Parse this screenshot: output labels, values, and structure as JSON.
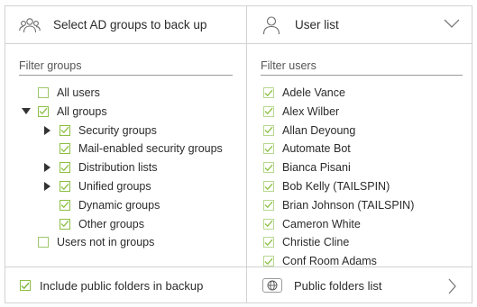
{
  "groups_panel": {
    "title": "Select AD groups to back up",
    "icon": "people-icon",
    "filter_label": "Filter groups",
    "items": [
      {
        "label": "All users",
        "checked": false,
        "level": 0,
        "expander": null
      },
      {
        "label": "All groups",
        "checked": true,
        "level": 0,
        "expander": "expanded"
      },
      {
        "label": "Security groups",
        "checked": true,
        "level": 1,
        "expander": "collapsed"
      },
      {
        "label": "Mail-enabled security groups",
        "checked": true,
        "level": 1,
        "expander": null
      },
      {
        "label": "Distribution lists",
        "checked": true,
        "level": 1,
        "expander": "collapsed"
      },
      {
        "label": "Unified groups",
        "checked": true,
        "level": 1,
        "expander": "collapsed"
      },
      {
        "label": "Dynamic groups",
        "checked": true,
        "level": 1,
        "expander": null
      },
      {
        "label": "Other groups",
        "checked": true,
        "level": 1,
        "expander": null
      },
      {
        "label": "Users not in groups",
        "checked": false,
        "level": 0,
        "expander": null
      }
    ]
  },
  "users_panel": {
    "title": "User list",
    "icon": "user-icon",
    "filter_label": "Filter users",
    "users": [
      "Adele Vance",
      "Alex Wilber",
      "Allan Deyoung",
      "Automate Bot",
      "Bianca Pisani",
      "Bob Kelly (TAILSPIN)",
      "Brian Johnson (TAILSPIN)",
      "Cameron White",
      "Christie Cline",
      "Conf Room Adams"
    ]
  },
  "footer": {
    "include_public_folders_label": "Include public folders in backup",
    "include_public_folders_checked": true,
    "public_folders_list_label": "Public folders list"
  },
  "colors": {
    "accent_green": "#7ab23a",
    "border": "#d2d2d2"
  }
}
